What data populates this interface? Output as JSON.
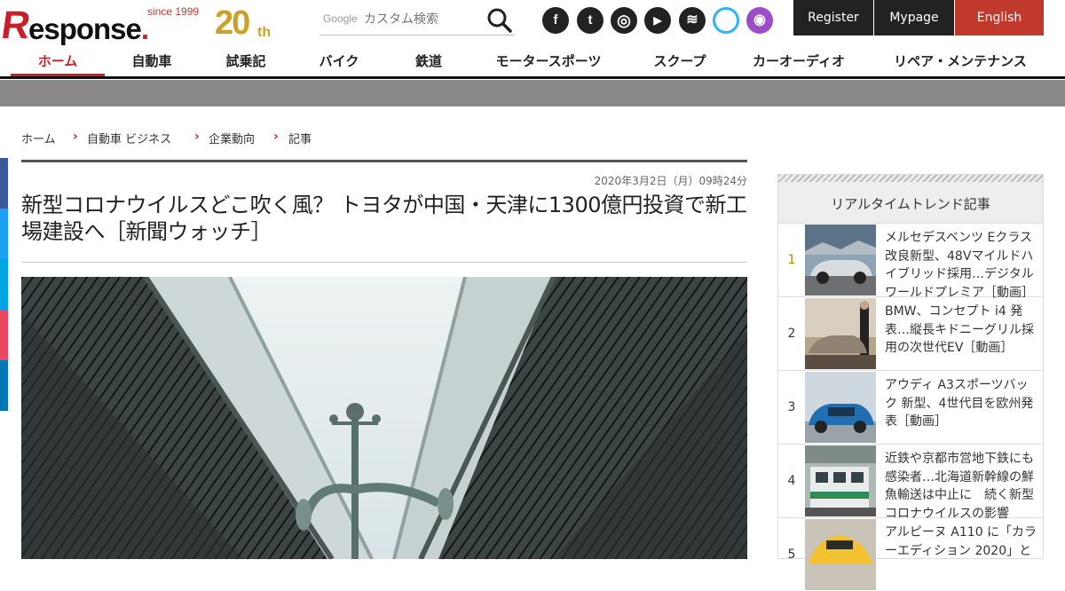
{
  "brand": {
    "since": "since 1999",
    "r": "R",
    "word": "esponse",
    "dot": ".",
    "twenty": "20",
    "th": "th",
    "logo_color": "#c8202a",
    "gold": "#c9a227"
  },
  "search": {
    "brand": "Google",
    "placeholder": "カスタム検索"
  },
  "social": [
    {
      "name": "facebook-icon",
      "glyph": "f"
    },
    {
      "name": "twitter-icon",
      "glyph": "t"
    },
    {
      "name": "instagram-icon",
      "glyph": "◎"
    },
    {
      "name": "youtube-icon",
      "glyph": "▶"
    },
    {
      "name": "rss-icon",
      "glyph": "≋"
    },
    {
      "name": "alexa-icon",
      "glyph": ""
    },
    {
      "name": "podcast-icon",
      "glyph": "◉"
    }
  ],
  "account": {
    "register": "Register",
    "mypage": "Mypage",
    "english": "English"
  },
  "nav": [
    "ホーム",
    "自動車",
    "試乗記",
    "バイク",
    "鉄道",
    "モータースポーツ",
    "スクープ",
    "カーオーディオ",
    "リペア・メンテナンス"
  ],
  "breadcrumb": [
    "ホーム",
    "自動車 ビジネス",
    "企業動向",
    "記事"
  ],
  "article": {
    "date": "2020年3月2日（月）09時24分",
    "title": "新型コロナウイルスどこ吹く風？ トヨタが中国・天津に1300億円投資で新工場建設へ［新聞ウォッチ］"
  },
  "sidebar": {
    "heading": "リアルタイムトレンド記事",
    "items": [
      {
        "rank": "1",
        "text": "メルセデスベンツ Eクラス 改良新型、48Vマイルドハイブリッド採用…デジタルワールドプレミア［動画］"
      },
      {
        "rank": "2",
        "text": "BMW、コンセプト i4 発表…縦長キドニーグリル採用の次世代EV［動画］"
      },
      {
        "rank": "3",
        "text": "アウディ A3スポーツバック 新型、4世代目を欧州発表［動画］"
      },
      {
        "rank": "4",
        "text": "近鉄や京都市営地下鉄にも感染者…北海道新幹線の鮮魚輸送は中止に　続く新型コロナウイルスの影響"
      },
      {
        "rank": "5",
        "text": "アルピーヌ A110 に「カラーエディション 2020」と"
      }
    ]
  },
  "colors": {
    "accent": "#c8202a",
    "dark": "#222222",
    "english_bg": "#c0392b",
    "gray_band": "#888888"
  }
}
